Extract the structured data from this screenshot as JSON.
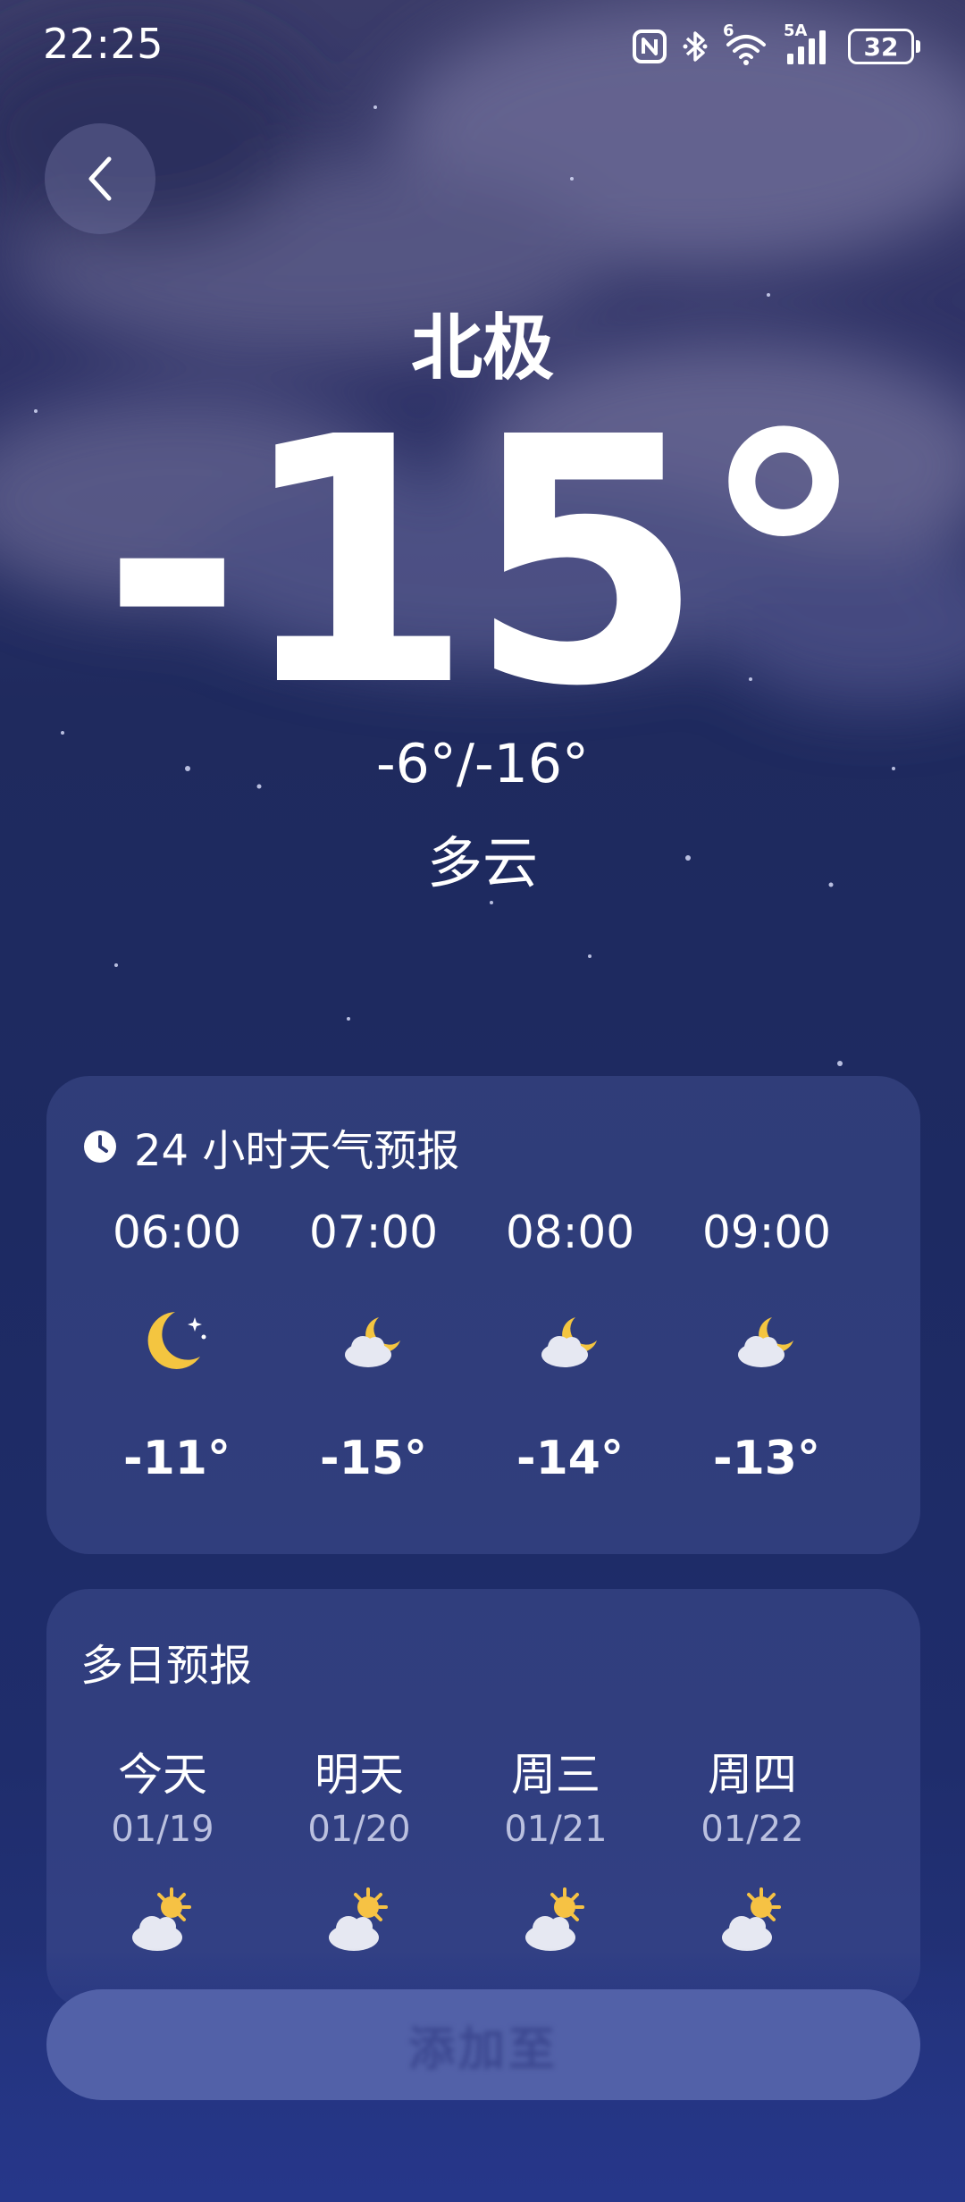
{
  "status_bar": {
    "time": "22:25",
    "battery": "32",
    "icons": [
      "nfc-icon",
      "bluetooth-icon",
      "wifi-icon",
      "signal-icon",
      "battery-icon"
    ],
    "wifi_badge": "6",
    "signal_badge": "5A"
  },
  "header": {
    "back_icon": "chevron-left-icon"
  },
  "current": {
    "city": "北极",
    "temperature": "-15°",
    "range": "-6°/-16°",
    "condition": "多云"
  },
  "hourly": {
    "title": "24 小时天气预报",
    "title_icon": "clock-icon",
    "items": [
      {
        "time": "06:00",
        "icon": "crescent-moon-stars-icon",
        "temp": "-11°"
      },
      {
        "time": "07:00",
        "icon": "cloudy-night-icon",
        "temp": "-15°"
      },
      {
        "time": "08:00",
        "icon": "cloudy-night-icon",
        "temp": "-14°"
      },
      {
        "time": "09:00",
        "icon": "cloudy-night-icon",
        "temp": "-13°"
      }
    ]
  },
  "daily": {
    "title": "多日预报",
    "items": [
      {
        "day": "今天",
        "date": "01/19",
        "icon": "partly-sunny-icon"
      },
      {
        "day": "明天",
        "date": "01/20",
        "icon": "partly-sunny-icon"
      },
      {
        "day": "周三",
        "date": "01/21",
        "icon": "partly-sunny-icon"
      },
      {
        "day": "周四",
        "date": "01/22",
        "icon": "partly-sunny-icon"
      }
    ]
  },
  "bottom_button": {
    "label": "添加至"
  },
  "colors": {
    "background_top": "#3b3c69",
    "background_bottom": "#253582",
    "card": "#3a4580",
    "sun": "#f6c244",
    "moon": "#f4c540",
    "cloud": "#e6e8f2",
    "button": "#5261a8"
  }
}
